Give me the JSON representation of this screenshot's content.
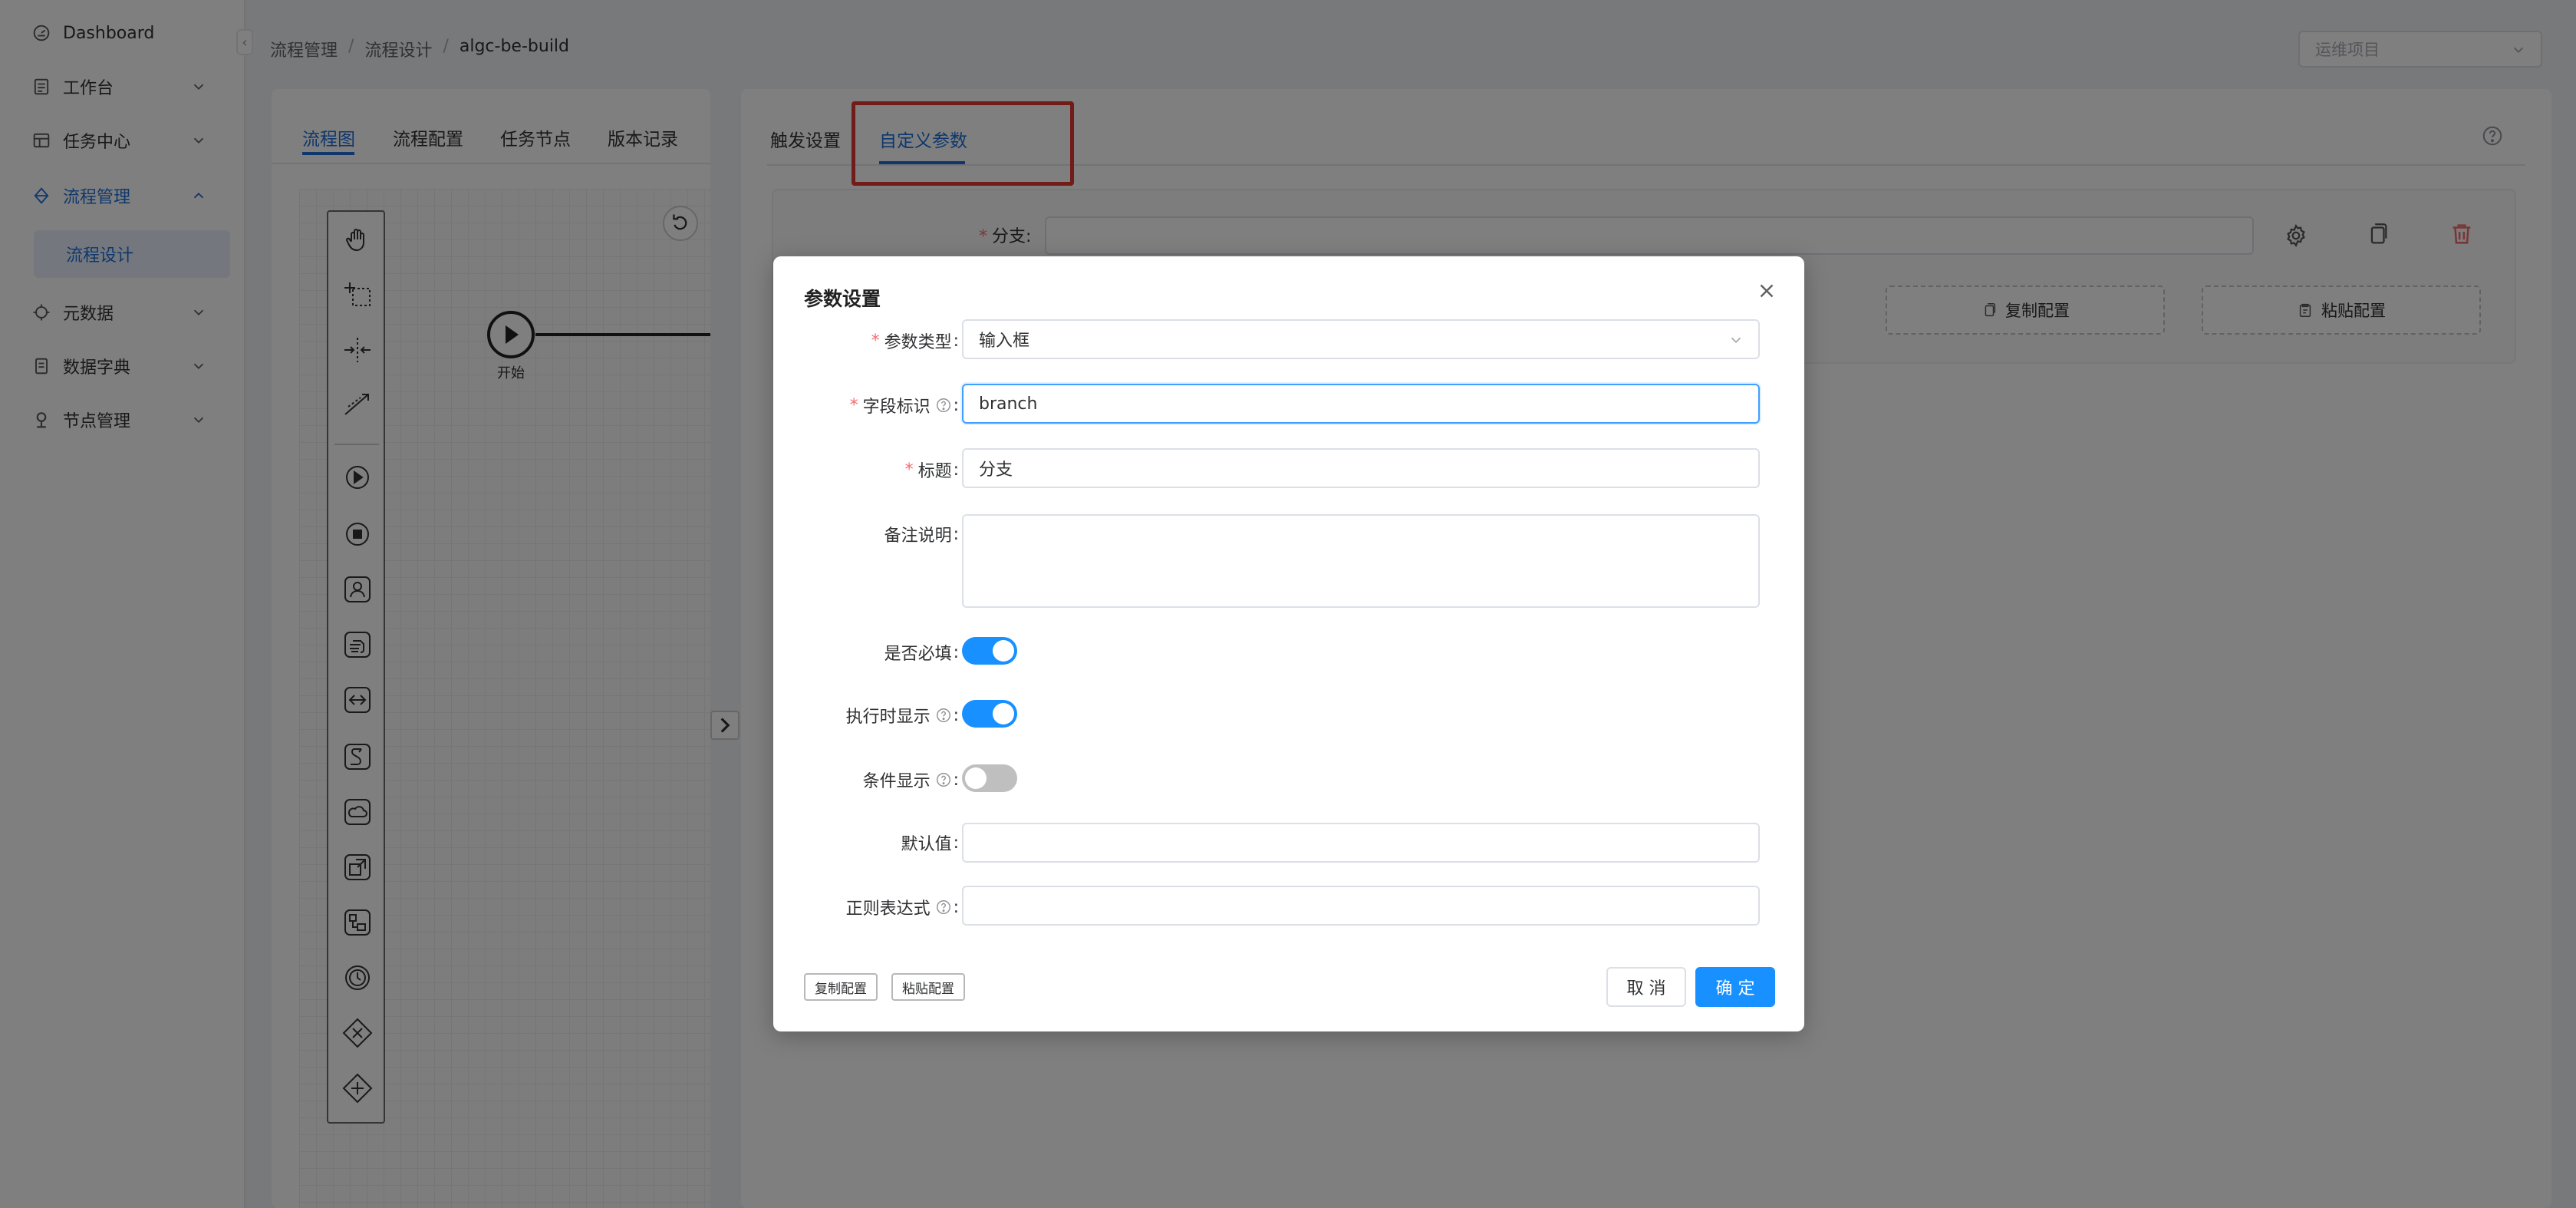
{
  "sidebar": {
    "items": [
      {
        "label": "Dashboard",
        "icon": "dashboard-icon"
      },
      {
        "label": "工作台",
        "icon": "workbench-icon"
      },
      {
        "label": "任务中心",
        "icon": "task-center-icon"
      },
      {
        "label": "流程管理",
        "icon": "flow-icon"
      },
      {
        "label": "流程设计"
      },
      {
        "label": "元数据",
        "icon": "metadata-icon"
      },
      {
        "label": "数据字典",
        "icon": "dictionary-icon"
      },
      {
        "label": "节点管理",
        "icon": "node-icon"
      }
    ],
    "collapse_glyph": "‹",
    "accent_color": "#1e6fd9"
  },
  "breadcrumb": [
    "流程管理",
    "流程设计",
    "algc-be-build"
  ],
  "breadcrumb_separator": "/",
  "project_select": {
    "placeholder": "运维项目"
  },
  "left_tabs": [
    "流程图",
    "流程配置",
    "任务节点",
    "版本记录"
  ],
  "flow": {
    "start_node_label": "开始"
  },
  "right_tabs": [
    "触发设置",
    "自定义参数"
  ],
  "param_panel": {
    "branch_label": "分支:",
    "copy_config": "复制配置",
    "paste_config": "粘贴配置"
  },
  "modal": {
    "title": "参数设置",
    "fields": {
      "param_type": {
        "label": "参数类型",
        "value": "输入框"
      },
      "field_id": {
        "label": "字段标识",
        "value": "branch"
      },
      "title": {
        "label": "标题",
        "value": "分支"
      },
      "remark": {
        "label": "备注说明",
        "value": ""
      },
      "required": {
        "label": "是否必填",
        "on": true
      },
      "show_on_exec": {
        "label": "执行时显示",
        "on": true
      },
      "conditional": {
        "label": "条件显示",
        "on": false
      },
      "default_value": {
        "label": "默认值",
        "value": ""
      },
      "regex": {
        "label": "正则表达式",
        "value": ""
      }
    },
    "colon": ":",
    "required_mark": "*",
    "copy_config": "复制配置",
    "paste_config": "粘贴配置",
    "cancel_label": "取 消",
    "confirm_label": "确 定",
    "primary_color": "#1890ff"
  },
  "highlight_color": "#e53935",
  "expand_glyph": "›"
}
